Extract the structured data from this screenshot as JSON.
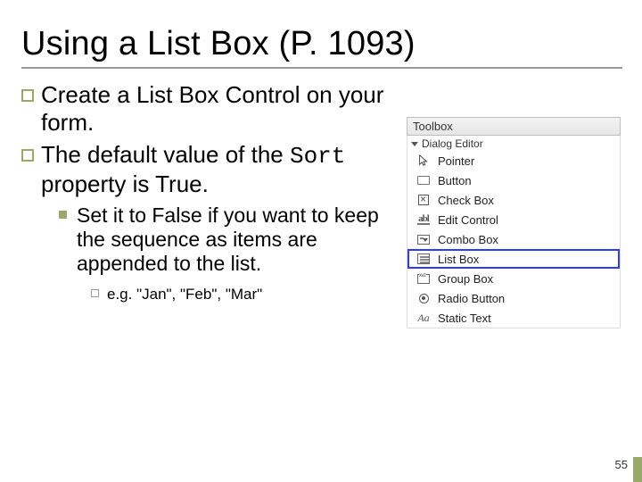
{
  "title": "Using a List Box (P. 1093)",
  "bullets": {
    "b1": "Create a List Box Control on your form.",
    "b2_pre": "The default value of the ",
    "b2_code": "Sort",
    "b2_post": " property is True.",
    "b2_sub": "Set it to False if you want to keep the sequence as items are appended to the list.",
    "b2_sub_sub": "e.g. \"Jan\", \"Feb\", \"Mar\""
  },
  "toolbox": {
    "title": "Toolbox",
    "section": "Dialog Editor",
    "items": [
      {
        "name": "pointer",
        "label": "Pointer"
      },
      {
        "name": "button",
        "label": "Button"
      },
      {
        "name": "checkbox",
        "label": "Check Box"
      },
      {
        "name": "edit",
        "label": "Edit Control"
      },
      {
        "name": "combo",
        "label": "Combo Box"
      },
      {
        "name": "listbox",
        "label": "List Box"
      },
      {
        "name": "groupbox",
        "label": "Group Box"
      },
      {
        "name": "radio",
        "label": "Radio Button"
      },
      {
        "name": "static",
        "label": "Static Text"
      }
    ],
    "selected": "listbox"
  },
  "page_number": "55"
}
